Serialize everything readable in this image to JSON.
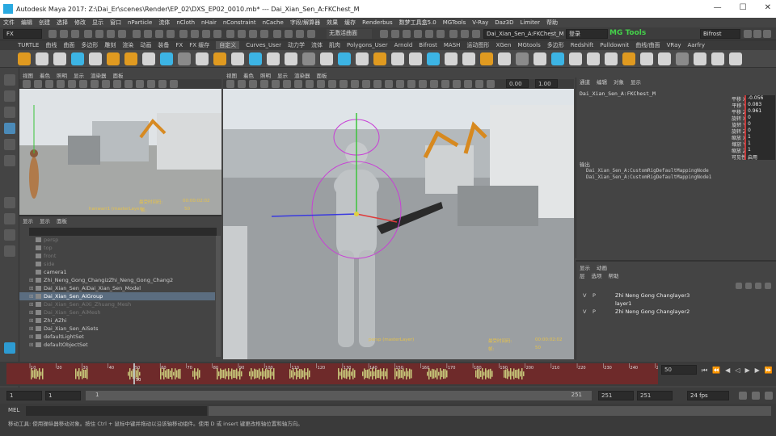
{
  "window": {
    "title": "Autodesk Maya 2017: Z:\\Dai_Er\\scenes\\Render\\EP_02\\DXS_EP02_0010.mb*  ---  Dai_Xian_Sen_A:FKChest_M",
    "controls": [
      "—",
      "☐",
      "✕"
    ]
  },
  "menubar": [
    "文件",
    "编辑",
    "创建",
    "选择",
    "修改",
    "显示",
    "窗口",
    "nParticle",
    "流体",
    "nCloth",
    "nHair",
    "nConstraint",
    "nCache",
    "字段/解算器",
    "效果",
    "缓存",
    "Renderbus",
    "数梦工具盒5.0",
    "MGTools",
    "V-Ray",
    "Daz3D",
    "Limiter",
    "帮助"
  ],
  "statusline": {
    "menuset": "FX",
    "live_surface": "无激活曲面",
    "current_object": "Dai_Xian_Sen_A:FKChest_M",
    "login": "登录",
    "mgtools_logo": "MG Tools",
    "bifrost": "Bifrost"
  },
  "shelf_tabs": [
    "TURTLE",
    "曲线",
    "曲面",
    "多边形",
    "雕刻",
    "渲染",
    "动画",
    "装备",
    "FX",
    "FX 缓存",
    "自定义",
    "Curves_User",
    "动力学",
    "流体",
    "肌肉",
    "Polygons_User",
    "Arnold",
    "Bifrost",
    "MASH",
    "运动图形",
    "XGen",
    "MGtools",
    "多边形",
    "Redshift",
    "Pulldownit",
    "曲线/曲面",
    "VRay",
    "Aarfry"
  ],
  "shelf_active": "自定义",
  "viewport_menu": [
    "视图",
    "着色",
    "照明",
    "显示",
    "渲染器",
    "面板"
  ],
  "viewport_left": {
    "hud_left": "最受时间码:",
    "hud_right": "00:00:02:02",
    "hud_cam": "hanwarr1 (masterLayer)",
    "hud_frame_label": "帧:",
    "hud_frame": "50"
  },
  "viewport_main": {
    "exposure": "0.00",
    "gamma": "1.00",
    "hud_left": "persp (masterLayer)",
    "hud_frame_label": "帧:",
    "hud_frame": "50",
    "hud_time_label": "最受时间码:",
    "hud_time": "00:00:02:02"
  },
  "outliner": {
    "menu": [
      "显示",
      "显示",
      "面板"
    ],
    "items": [
      {
        "label": "persp",
        "dim": true,
        "exp": false
      },
      {
        "label": "top",
        "dim": true,
        "exp": false
      },
      {
        "label": "front",
        "dim": true,
        "exp": false
      },
      {
        "label": "side",
        "dim": true,
        "exp": false
      },
      {
        "label": "camera1",
        "dim": false,
        "exp": false
      },
      {
        "label": "Zhi_Neng_Gong_ChangizZhi_Neng_Gong_Chang2",
        "dim": false,
        "exp": true
      },
      {
        "label": "Dai_Xian_Sen_AiDai_Xian_Sen_Model",
        "dim": false,
        "exp": true
      },
      {
        "label": "Dai_Xian_Sen_AiGroup",
        "dim": false,
        "exp": true,
        "sel": true
      },
      {
        "label": "Dai_Xian_Sen_AiXi_Zhuang_Mesh",
        "dim": true,
        "exp": true
      },
      {
        "label": "Dai_Xian_Sen_AiMesh",
        "dim": true,
        "exp": true
      },
      {
        "label": "Zhi_AZhi",
        "dim": false,
        "exp": true
      },
      {
        "label": "Dai_Xian_Sen_AiSets",
        "dim": false,
        "exp": true
      },
      {
        "label": "defaultLightSet",
        "dim": false,
        "exp": true
      },
      {
        "label": "defaultObjectSet",
        "dim": false,
        "exp": true
      }
    ]
  },
  "channelbox": {
    "menu": [
      "通道",
      "编辑",
      "对象",
      "显示"
    ],
    "object": "Dai_Xian_Sen_A:FKChest_M",
    "channels": [
      {
        "name": "平移 X",
        "value": "-0.056"
      },
      {
        "name": "平移 Y",
        "value": "0.083"
      },
      {
        "name": "平移 Z",
        "value": "0.961"
      },
      {
        "name": "旋转 X",
        "value": "0"
      },
      {
        "name": "旋转 Y",
        "value": "0"
      },
      {
        "name": "旋转 Z",
        "value": "0"
      },
      {
        "name": "缩放 X",
        "value": "1"
      },
      {
        "name": "缩放 Y",
        "value": "1"
      },
      {
        "name": "缩放 Z",
        "value": "1"
      },
      {
        "name": "可见性",
        "value": "启用"
      }
    ],
    "outputs_label": "输出",
    "outputs": [
      "Dai_Xian_Sen_A:CustomRigDefaultMappingNode",
      "Dai_Xian_Sen_A:CustomRigDefaultMappingNode1"
    ]
  },
  "layers": {
    "tabs": [
      "显示",
      "动画"
    ],
    "menu": [
      "层",
      "选项",
      "帮助"
    ],
    "items": [
      {
        "v": "V",
        "p": "P",
        "name": "Zhi Neng Gong Changlayer3"
      },
      {
        "v": "",
        "p": "",
        "name": "layer1"
      },
      {
        "v": "V",
        "p": "P",
        "name": "Zhi Neng Gong Changlayer2"
      }
    ]
  },
  "timeline": {
    "current_frame": "50",
    "ticks": [
      "10",
      "20",
      "30",
      "40",
      "50",
      "60",
      "70",
      "80",
      "90",
      "100",
      "110",
      "120",
      "130",
      "140",
      "150",
      "160",
      "170",
      "180",
      "190",
      "200",
      "210",
      "220",
      "230",
      "240",
      "250"
    ],
    "playhead_label": "50",
    "start": 1,
    "end": 251,
    "current": 50
  },
  "rangebar": {
    "start": "1",
    "playback_start": "1",
    "slider_start": "1",
    "slider_end": "251",
    "playback_end": "251",
    "end": "251",
    "fps": "24 fps"
  },
  "mel": {
    "label": "MEL"
  },
  "helpline": "移动工具: 使用操纵器移动对象。按住 Ctrl + 鼠标中键并拖动以沿该轴移动组件。使用 D 或 insert 键更改枢轴位置和轴方向。",
  "colors": {
    "timeline_bg": "#6e2a2a",
    "timeline_key": "#c8c87a",
    "selected": "#5b6d80",
    "hud": "#e6c24a"
  }
}
